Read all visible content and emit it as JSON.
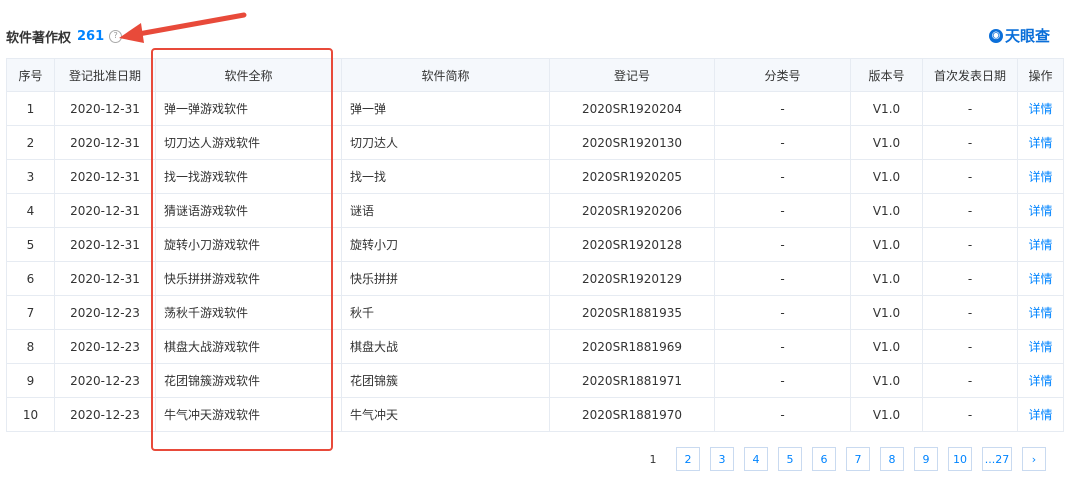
{
  "header": {
    "title": "软件著作权",
    "count": "261",
    "help_icon": "?"
  },
  "brand": {
    "icon": "eye-logo",
    "name": "天眼查",
    "color": "#0b6fd9"
  },
  "accent_color": "#0084ff",
  "highlight_color": "#e84a3a",
  "table": {
    "columns": [
      "序号",
      "登记批准日期",
      "软件全称",
      "软件简称",
      "登记号",
      "分类号",
      "版本号",
      "首次发表日期",
      "操作"
    ],
    "rows": [
      [
        "1",
        "2020-12-31",
        "弹一弹游戏软件",
        "弹一弹",
        "2020SR1920204",
        "-",
        "V1.0",
        "-",
        "详情"
      ],
      [
        "2",
        "2020-12-31",
        "切刀达人游戏软件",
        "切刀达人",
        "2020SR1920130",
        "-",
        "V1.0",
        "-",
        "详情"
      ],
      [
        "3",
        "2020-12-31",
        "找一找游戏软件",
        "找一找",
        "2020SR1920205",
        "-",
        "V1.0",
        "-",
        "详情"
      ],
      [
        "4",
        "2020-12-31",
        "猜谜语游戏软件",
        "谜语",
        "2020SR1920206",
        "-",
        "V1.0",
        "-",
        "详情"
      ],
      [
        "5",
        "2020-12-31",
        "旋转小刀游戏软件",
        "旋转小刀",
        "2020SR1920128",
        "-",
        "V1.0",
        "-",
        "详情"
      ],
      [
        "6",
        "2020-12-31",
        "快乐拼拼游戏软件",
        "快乐拼拼",
        "2020SR1920129",
        "-",
        "V1.0",
        "-",
        "详情"
      ],
      [
        "7",
        "2020-12-23",
        "荡秋千游戏软件",
        "秋千",
        "2020SR1881935",
        "-",
        "V1.0",
        "-",
        "详情"
      ],
      [
        "8",
        "2020-12-23",
        "棋盘大战游戏软件",
        "棋盘大战",
        "2020SR1881969",
        "-",
        "V1.0",
        "-",
        "详情"
      ],
      [
        "9",
        "2020-12-23",
        "花团锦簇游戏软件",
        "花团锦簇",
        "2020SR1881971",
        "-",
        "V1.0",
        "-",
        "详情"
      ],
      [
        "10",
        "2020-12-23",
        "牛气冲天游戏软件",
        "牛气冲天",
        "2020SR1881970",
        "-",
        "V1.0",
        "-",
        "详情"
      ]
    ]
  },
  "pagination": {
    "current": "1",
    "pages": [
      "2",
      "3",
      "4",
      "5",
      "6",
      "7",
      "8",
      "9",
      "10",
      "...27"
    ],
    "next_icon": "›"
  }
}
